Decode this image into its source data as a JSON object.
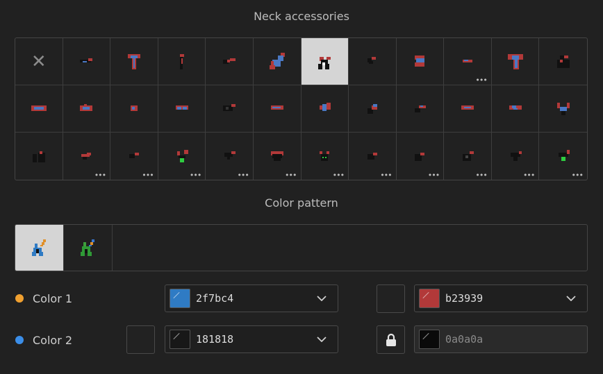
{
  "section1": {
    "title": "Neck accessories"
  },
  "section2": {
    "title": "Color pattern"
  },
  "accessories": [
    {
      "icon": "none-x-icon",
      "more": false,
      "selected": false
    },
    {
      "icon": "bandana-icon",
      "more": false,
      "selected": false
    },
    {
      "icon": "long-scarf-icon",
      "more": false,
      "selected": false
    },
    {
      "icon": "tie-icon",
      "more": false,
      "selected": false
    },
    {
      "icon": "bowtie-icon",
      "more": false,
      "selected": false
    },
    {
      "icon": "cape-scarf-icon",
      "more": false,
      "selected": false
    },
    {
      "icon": "collar-icon",
      "more": false,
      "selected": true
    },
    {
      "icon": "small-pendant-icon",
      "more": false,
      "selected": false
    },
    {
      "icon": "folded-scarf-icon",
      "more": false,
      "selected": false
    },
    {
      "icon": "thin-band-icon",
      "more": true,
      "selected": false
    },
    {
      "icon": "long-cape-icon",
      "more": false,
      "selected": false
    },
    {
      "icon": "hood-collar-icon",
      "more": false,
      "selected": false
    },
    {
      "icon": "wrap-scarf-icon",
      "more": false,
      "selected": false
    },
    {
      "icon": "knot-scarf-icon",
      "more": false,
      "selected": false
    },
    {
      "icon": "small-knot-icon",
      "more": false,
      "selected": false
    },
    {
      "icon": "goggles-icon",
      "more": false,
      "selected": false
    },
    {
      "icon": "dark-band-icon",
      "more": false,
      "selected": false
    },
    {
      "icon": "short-scarf-icon",
      "more": false,
      "selected": false
    },
    {
      "icon": "tied-scarf-icon",
      "more": false,
      "selected": false
    },
    {
      "icon": "bell-collar-icon",
      "more": false,
      "selected": false
    },
    {
      "icon": "pendant-chain-icon",
      "more": false,
      "selected": false
    },
    {
      "icon": "striped-band-icon",
      "more": false,
      "selected": false
    },
    {
      "icon": "twist-scarf-icon",
      "more": false,
      "selected": false
    },
    {
      "icon": "v-necklace-icon",
      "more": false,
      "selected": false
    },
    {
      "icon": "beads-icon",
      "more": false,
      "selected": false
    },
    {
      "icon": "heart-pendant-icon",
      "more": true,
      "selected": false
    },
    {
      "icon": "small-collar-icon",
      "more": true,
      "selected": false
    },
    {
      "icon": "gem-necklace-icon",
      "more": true,
      "selected": false
    },
    {
      "icon": "dark-pendant-icon",
      "more": true,
      "selected": false
    },
    {
      "icon": "bib-icon",
      "more": true,
      "selected": false
    },
    {
      "icon": "skull-pendant-icon",
      "more": true,
      "selected": false
    },
    {
      "icon": "round-pendant-icon",
      "more": true,
      "selected": false
    },
    {
      "icon": "bead-pendant-icon",
      "more": true,
      "selected": false
    },
    {
      "icon": "spiked-pendant-icon",
      "more": true,
      "selected": false
    },
    {
      "icon": "star-pendant-icon",
      "more": true,
      "selected": false
    },
    {
      "icon": "green-gem-icon",
      "more": true,
      "selected": false
    }
  ],
  "patterns": [
    {
      "icon": "blue-orange-pattern-icon",
      "selected": true
    },
    {
      "icon": "green-blue-pattern-icon",
      "selected": false
    }
  ],
  "colors": {
    "color1": {
      "label": "Color 1",
      "dot": "#f0a030",
      "primary": {
        "hex": "2f7bc4",
        "swatch": "#2f7bc4"
      },
      "secondary": {
        "hex": "b23939",
        "swatch": "#b23939"
      }
    },
    "color2": {
      "label": "Color 2",
      "dot": "#3b8ee8",
      "primary": {
        "hex": "181818",
        "swatch": "#181818"
      },
      "secondary": {
        "hex": "0a0a0a",
        "swatch": "#0a0a0a",
        "locked": true
      }
    }
  }
}
